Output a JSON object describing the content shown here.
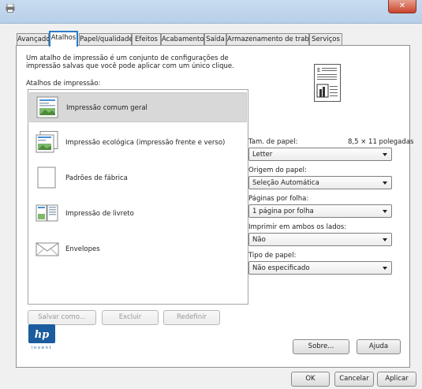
{
  "window": {
    "close_glyph": "✕"
  },
  "tabs": [
    "Avançado",
    "Atalhos",
    "Papel/qualidade",
    "Efeitos",
    "Acabamento",
    "Saída",
    "Armazenamento de trabalho",
    "Serviços"
  ],
  "active_tab": "Atalhos",
  "description": "Um atalho de impressão é um conjunto de configurações de impressão salvas que você pode aplicar com um único clique.",
  "shortcuts_label": "Atalhos de impressão:",
  "shortcuts": [
    {
      "label": "Impressão comum geral",
      "icon": "document-icon",
      "selected": true
    },
    {
      "label": "Impressão ecológica (impressão frente e verso)",
      "icon": "duplex-icon",
      "selected": false
    },
    {
      "label": "Padrões de fábrica",
      "icon": "blank-page-icon",
      "selected": false
    },
    {
      "label": "Impressão de livreto",
      "icon": "booklet-icon",
      "selected": false
    },
    {
      "label": "Envelopes",
      "icon": "envelope-icon",
      "selected": false
    }
  ],
  "list_buttons": {
    "save_as": "Salvar como...",
    "delete": "Excluir",
    "reset": "Redefinir"
  },
  "settings": {
    "paper_size_label": "Tam. de papel:",
    "paper_size_value": "8,5 × 11 polegadas",
    "paper_size_select": "Letter",
    "paper_source_label": "Origem do papel:",
    "paper_source_select": "Seleção Automática",
    "pages_per_sheet_label": "Páginas por folha:",
    "pages_per_sheet_select": "1 página por folha",
    "duplex_label": "Imprimir em ambos os lados:",
    "duplex_select": "Não",
    "paper_type_label": "Tipo de papel:",
    "paper_type_select": "Não especificado"
  },
  "logo_text": "invent",
  "panel_buttons": {
    "about": "Sobre...",
    "help": "Ajuda"
  },
  "dialog_buttons": {
    "ok": "OK",
    "cancel": "Cancelar",
    "apply": "Aplicar"
  },
  "colors": {
    "accent": "#2a7ac8",
    "close": "#c8442c",
    "hp_blue": "#1a5c9e"
  }
}
